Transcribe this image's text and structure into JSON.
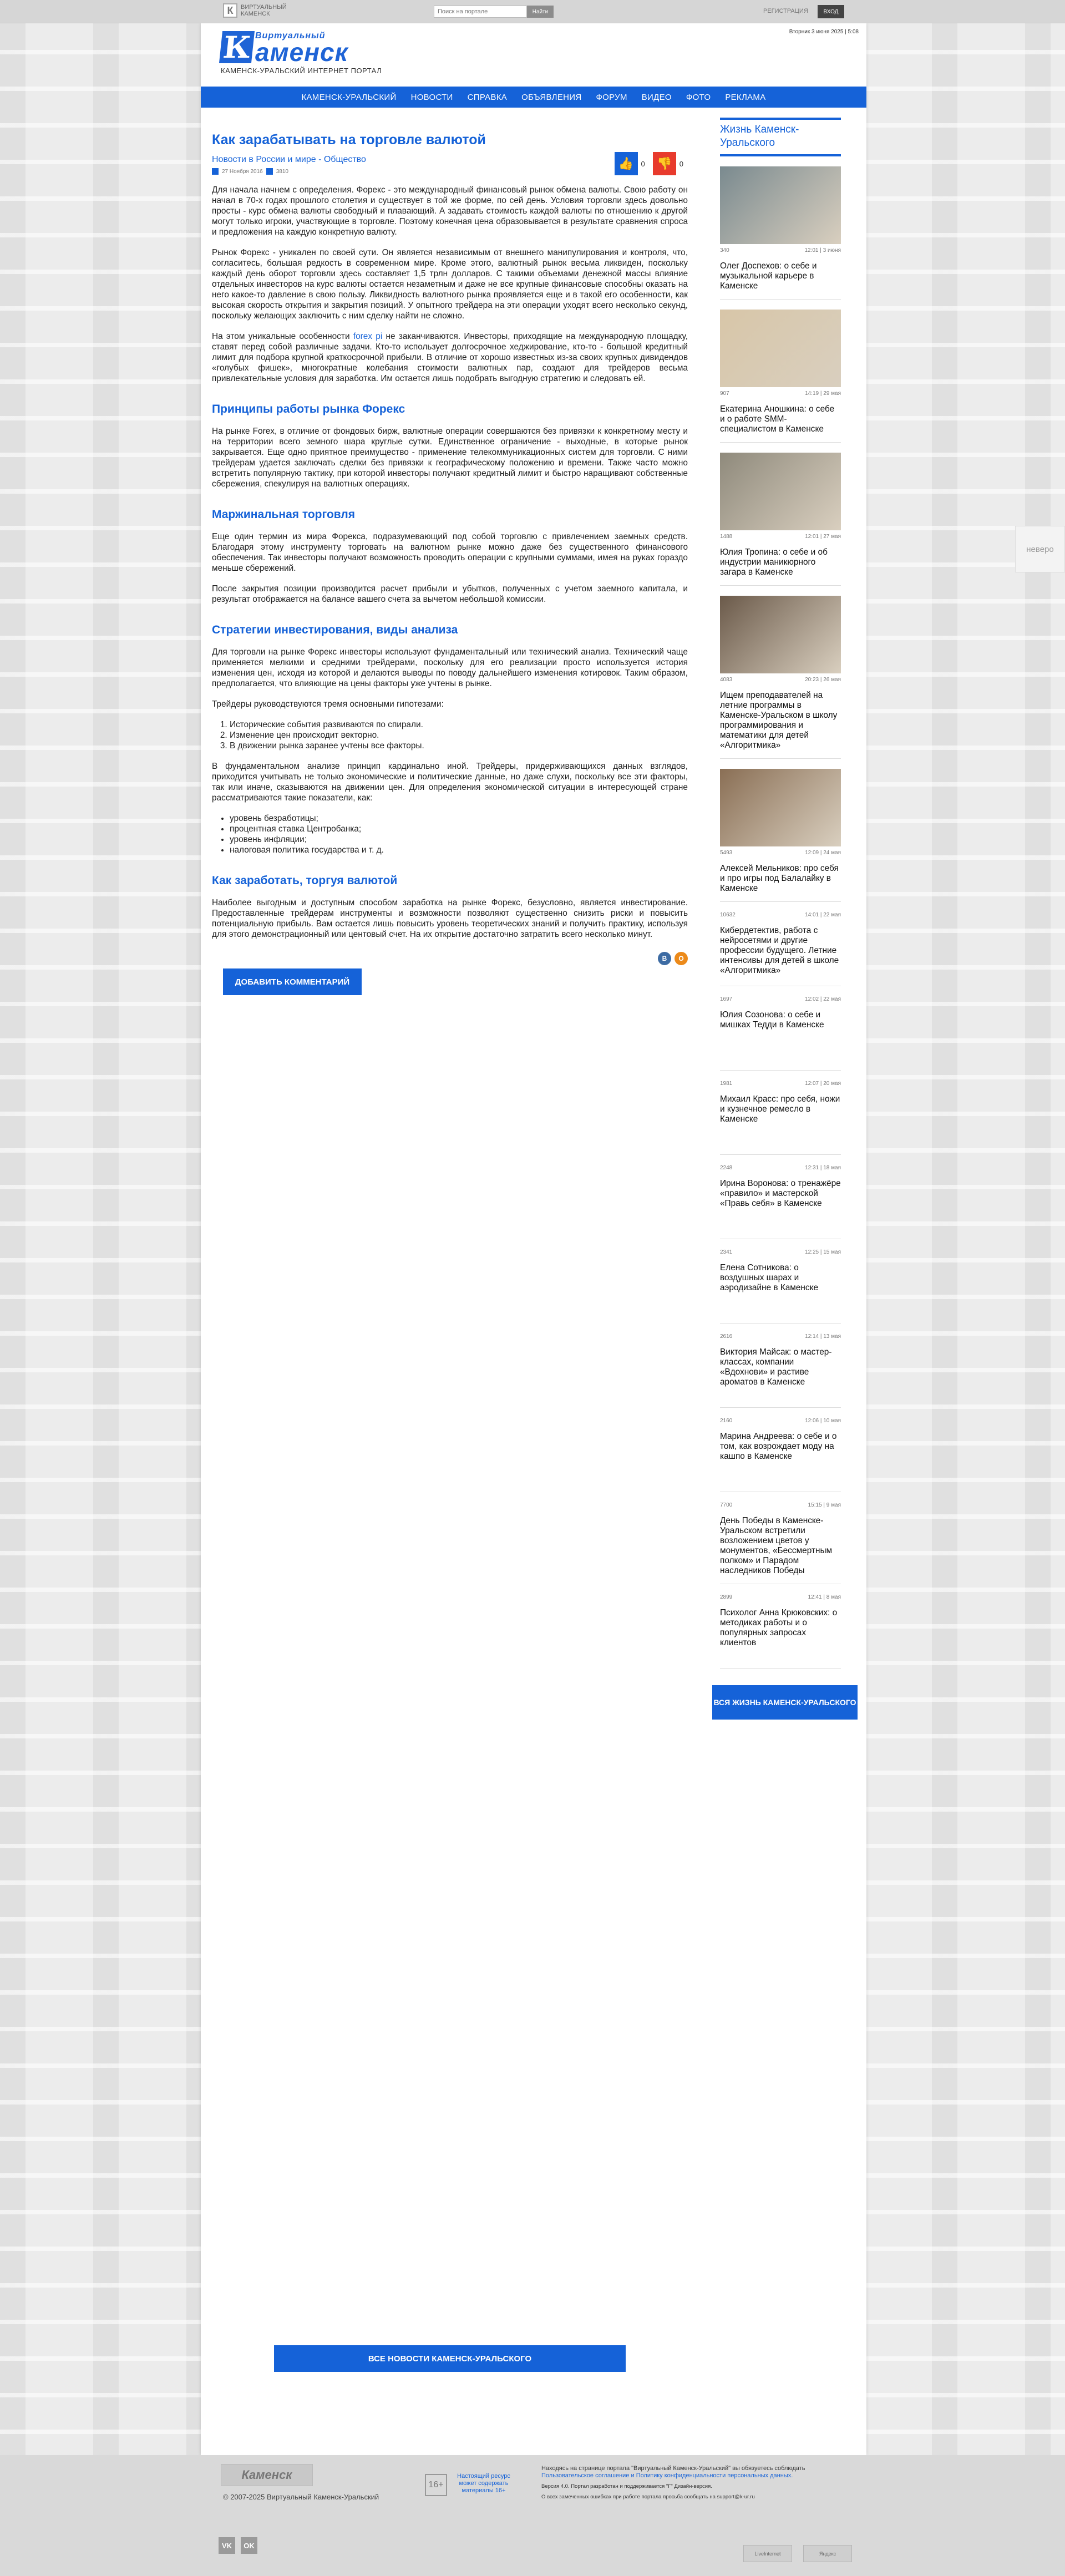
{
  "topbar": {
    "logo_text": "Виртуальный Каменск",
    "search_placeholder": "Поиск на портале",
    "search_button": "Найти",
    "register": "Регистрация",
    "login": "Вход"
  },
  "header": {
    "date": "Вторник 3 июня 2025 | 5:08",
    "logo_small": "Виртуальный",
    "logo_big": "аменск",
    "logo_letter": "К",
    "logo_sub": "Каменск-Уральский интернет портал"
  },
  "nav": [
    "Каменск-Уральский",
    "Новости",
    "Справка",
    "Объявления",
    "Форум",
    "Видео",
    "Фото",
    "Реклама"
  ],
  "article": {
    "title": "Как зарабатывать на торговле валютой",
    "category": "Новости в России и мире - Общество",
    "date": "27 Ноября 2016",
    "views": "3810",
    "votes_up": "0",
    "votes_down": "0",
    "p1": "Для начала начнем с определения. Форекс - это международный финансовый рынок обмена валюты. Свою работу он начал в 70-х годах прошлого столетия и существует в той же форме, по сей день. Условия торговли здесь довольно просты - курс обмена валюты свободный и плавающий. А задавать стоимость каждой валюты по отношению к другой могут только игроки, участвующие в торговле. Поэтому конечная цена образовывается в результате сравнения спроса и предложения на каждую конкретную валюту.",
    "p2": "Рынок Форекс - уникален по своей сути. Он является независимым от внешнего манипулирования и контроля, что, согласитесь, большая редкость в современном мире. Кроме этого, валютный рынок весьма ликвиден, поскольку каждый день оборот торговли здесь составляет 1,5 трлн долларов. С такими объемами денежной массы влияние отдельных инвесторов на курс валюты остается незаметным и даже не все крупные финансовые способны оказать на него какое-то давление в свою пользу. Ликвидность валютного рынка проявляется еще и в такой его особенности, как высокая скорость открытия и закрытия позиций. У опытного трейдера на эти операции уходят всего несколько секунд, поскольку желающих заключить с ним сделку найти не сложно.",
    "p3a": "На этом уникальные особенности ",
    "p3_link": "forex pi",
    "p3b": " не заканчиваются. Инвесторы, приходящие на международную площадку, ставят перед собой различные задачи. Кто-то использует долгосрочное хеджирование, кто-то - большой кредитный лимит для подбора крупной краткосрочной прибыли. В отличие от хорошо известных из-за своих крупных дивидендов «голубых фишек», многократные колебания стоимости валютных пар, создают для трейдеров весьма привлекательные условия для заработка. Им остается лишь подобрать выгодную стратегию и следовать ей.",
    "h_principles": "Принципы работы рынка Форекс",
    "p4": "На рынке Forex, в отличие от фондовых бирж, валютные операции совершаются без привязки к конкретному месту и на территории всего земного шара круглые сутки. Единственное ограничение - выходные, в которые рынок закрывается. Еще одно приятное преимущество - применение телекоммуникационных систем для торговли. С ними трейдерам удается заключать сделки без привязки к географическому положению и времени. Также часто можно встретить популярную тактику, при которой инвесторы получают кредитный лимит и быстро наращивают собственные сбережения, спекулируя на валютных операциях.",
    "h_margin": "Маржинальная торговля",
    "p5": "Еще один термин из мира Форекса, подразумевающий под собой торговлю с привлечением заемных средств. Благодаря этому инструменту торговать на валютном рынке можно даже без существенного финансового обеспечения. Так инвесторы получают возможность проводить операции с крупными суммами, имея на руках гораздо меньше сбережений.",
    "p6": "После закрытия позиции производится расчет прибыли и убытков, полученных с учетом заемного капитала, и результат отображается на балансе вашего счета за вычетом небольшой комиссии.",
    "h_strategies": "Стратегии инвестирования, виды анализа",
    "p7": "Для торговли на рынке Форекс инвесторы используют фундаментальный или технический анализ. Технический чаще применяется мелкими и средними трейдерами, поскольку для его реализации просто используется история изменения цен, исходя из которой и делаются выводы по поводу дальнейшего изменения котировок. Таким образом, предполагается, что влияющие на цены факторы уже учтены в рынке.",
    "p8": "Трейдеры руководствуются тремя основными гипотезами:",
    "ol": [
      "Исторические события развиваются по спирали.",
      "Изменение цен происходит векторно.",
      "В движении рынка заранее учтены все факторы."
    ],
    "p9": "В фундаментальном анализе принцип кардинально иной. Трейдеры, придерживающихся данных взглядов, приходится учитывать не только экономические и политические данные, но даже слухи, поскольку все эти факторы, так или иначе, сказываются на движении цен. Для определения экономической ситуации в интересующей стране рассматриваются такие показатели, как:",
    "ul": [
      "уровень безработицы;",
      "процентная ставка Центробанка;",
      "уровень инфляции;",
      "налоговая политика государства и т. д."
    ],
    "h_earn": "Как заработать, торгуя валютой",
    "p10": "Наиболее выгодным и доступным способом заработка на рынке Форекс, безусловно, является инвестирование. Предоставленные трейдерам инструменты и возможности позволяют существенно снизить риски и повысить потенциальную прибыль. Вам остается лишь повысить уровень теоретических знаний и получить практику, используя для этого демонстрационный или центовый счет. На их открытие достаточно затратить всего несколько минут.",
    "share_vk": "В",
    "share_ok": "О",
    "add_comment": "Добавить комментарий"
  },
  "sidebar": {
    "heading": "Жизнь Каменск-Уральского",
    "items": [
      {
        "views": "340",
        "time": "12:01 | 3 июня",
        "title": "Олег Доспехов: о себе и музыкальной карьере в Каменске",
        "img": true,
        "color": "#7a8a8f"
      },
      {
        "views": "907",
        "time": "14:19 | 29 мая",
        "title": "Екатерина Аношкина: о себе и о работе SMM-специалистом в Каменске",
        "img": true,
        "color": "#d8c6a8"
      },
      {
        "views": "1488",
        "time": "12:01 | 27 мая",
        "title": "Юлия Тропина: о себе и об индустрии маникюрного загара в Каменске",
        "img": true,
        "color": "#8f8a7c"
      },
      {
        "views": "4083",
        "time": "20:23 | 26 мая",
        "title": "Ищем преподавателей на летние программы в Каменске-Уральском в школу программирования и математики для детей «Алгоритмика»",
        "img": true,
        "color": "#6b5a4a"
      },
      {
        "views": "5493",
        "time": "12:09 | 24 мая",
        "title": "Алексей Мельников: про себя и про игры под Балалайку в Каменске",
        "img": true,
        "color": "#8a6f55"
      },
      {
        "views": "10632",
        "time": "14:01 | 22 мая",
        "title": "Кибердетектив, работа с нейросетями и другие профессии будущего. Летние интенсивы для детей в школе «Алгоритмика»",
        "img": false
      },
      {
        "views": "1697",
        "time": "12:02 | 22 мая",
        "title": "Юлия Созонова: о себе и мишках Тедди в Каменске",
        "img": false
      },
      {
        "views": "1981",
        "time": "12:07 | 20 мая",
        "title": "Михаил Красс: про себя, ножи и кузнечное ремесло в Каменске",
        "img": false
      },
      {
        "views": "2248",
        "time": "12:31 | 18 мая",
        "title": "Ирина Воронова: о тренажёре «правило» и мастерской «Правь себя» в Каменске",
        "img": false
      },
      {
        "views": "2341",
        "time": "12:25 | 15 мая",
        "title": "Елена Сотникова: о воздушных шарах и аэродизайне в Каменске",
        "img": false
      },
      {
        "views": "2616",
        "time": "12:14 | 13 мая",
        "title": "Виктория Майсак: о мастер-классах, компании «Вдохнови» и растиве ароматов в Каменске",
        "img": false
      },
      {
        "views": "2160",
        "time": "12:06 | 10 мая",
        "title": "Марина Андреева: о себе и о том, как возрождает моду на кашпо в Каменске",
        "img": false
      },
      {
        "views": "7700",
        "time": "15:15 | 9 мая",
        "title": "День Победы в Каменске-Уральском встретили возложением цветов у монументов, «Бессмертным полком» и Парадом наследников Победы",
        "img": false
      },
      {
        "views": "2899",
        "time": "12:41 | 8 мая",
        "title": "Психолог Анна Крюковских: о методиках работы и о популярных запросах клиентов",
        "img": false
      }
    ],
    "all_button": "Вся жизнь Каменск-Уральского"
  },
  "all_news_button": "Все новости Каменск-Уральского",
  "side_next": "Неверо",
  "footer": {
    "logo": "Каменск",
    "copyright": "© 2007-2025 Виртуальный Каменск-Уральский",
    "age": "16+",
    "age_text": "Настоящий ресурс может содержать материалы 16+",
    "legal1": "Находясь на странице портала \"Виртуальный Каменск-Уральский\" вы обязуетесь соблюдать ",
    "legal_link": "Пользовательское соглашение и Политику конфиденциальности персональных данных.",
    "legal2": "Версия 4.0. Портал разработан и поддерживается \"Г\" Дизайн-версия.",
    "legal3": "О всех замеченных ошибках при работе портала просьба сообщать на support@k-ur.ru",
    "social": [
      "VK",
      "OK"
    ],
    "counters": [
      "LiveInternet",
      "Яндекс"
    ]
  }
}
